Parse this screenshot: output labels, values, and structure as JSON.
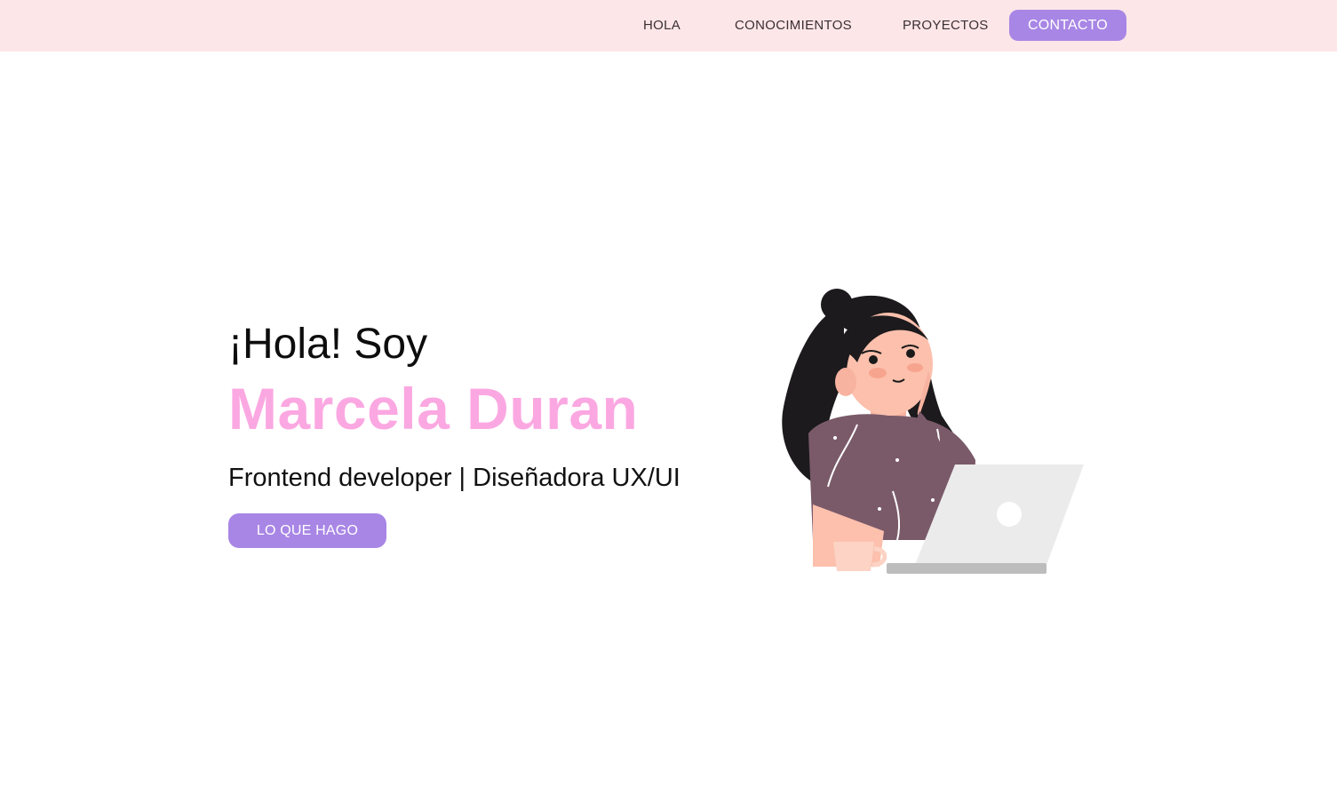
{
  "nav": {
    "items": [
      {
        "label": "HOLA"
      },
      {
        "label": "CONOCIMIENTOS"
      },
      {
        "label": "PROYECTOS"
      }
    ],
    "contact_label": "CONTACTO"
  },
  "hero": {
    "greeting": "¡Hola! Soy",
    "name": "Marcela Duran",
    "role": "Frontend developer | Diseñadora UX/UI",
    "button_label": "LO QUE HAGO"
  },
  "colors": {
    "nav_background": "#fde6e8",
    "accent_purple": "#a886e5",
    "name_pink": "#fba8e2"
  },
  "icons": {
    "illustration": "woman-with-laptop-illustration"
  }
}
